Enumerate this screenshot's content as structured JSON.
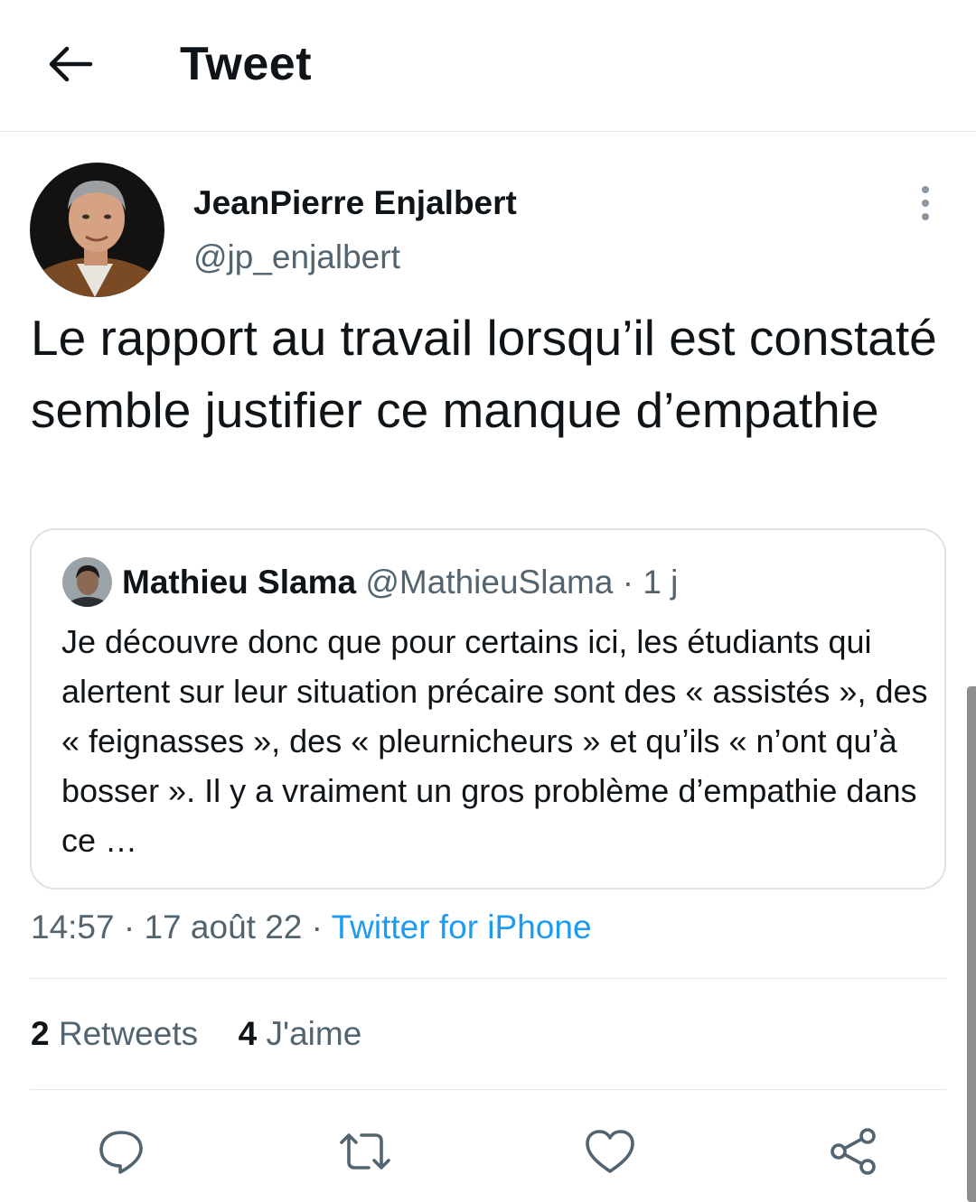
{
  "header": {
    "title": "Tweet",
    "back_icon": "arrow-left-icon"
  },
  "tweet": {
    "author_name": "JeanPierre Enjalbert",
    "author_handle": "@jp_enjalbert",
    "text": "Le rapport au travail lorsqu’il est constaté semble justifier ce manque d’empathie",
    "time": "14:57",
    "date": "17 août 22",
    "separator": "·",
    "source": "Twitter for iPhone",
    "more_icon": "more-vertical-icon"
  },
  "quote": {
    "author_name": "Mathieu Slama",
    "author_handle": "@MathieuSlama",
    "separator": "·",
    "age": "1 j",
    "text": "Je découvre donc que pour certains ici, les étudiants qui alertent sur leur situation précaire sont des « assistés », des « feignasses », des « pleurnicheurs » et qu’ils « n’ont qu’à bosser ». Il y a vraiment un gros problème d’empathie dans ce …"
  },
  "stats": {
    "retweets_count": "2",
    "retweets_label": "Retweets",
    "likes_count": "4",
    "likes_label": "J'aime"
  },
  "actions": [
    "reply-icon",
    "retweet-icon",
    "like-icon",
    "share-icon"
  ],
  "colors": {
    "link": "#1d9bf0",
    "secondary_text": "#536471",
    "border": "#e6e9eb"
  }
}
